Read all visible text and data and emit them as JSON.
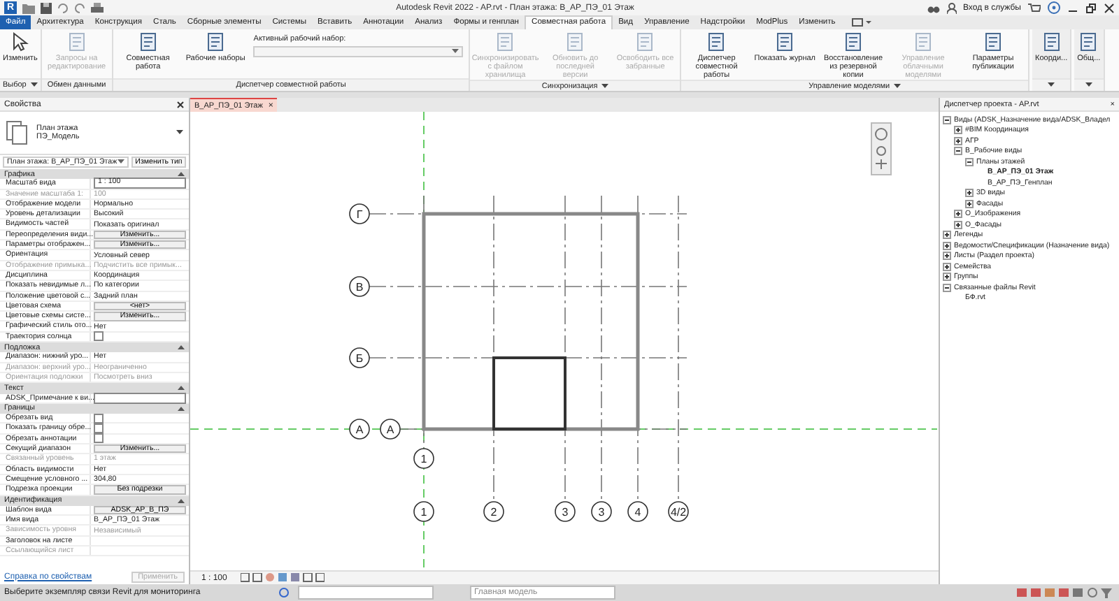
{
  "window": {
    "app_logo": "R",
    "title": "Autodesk Revit 2022 - AP.rvt - План этажа: В_АР_ПЭ_01 Этаж",
    "sign_in": "Вход в службы"
  },
  "ribbon_tabs": [
    {
      "label": "Файл",
      "kind": "file",
      "selected": false
    },
    {
      "label": "Архитектура",
      "kind": "tab",
      "selected": false
    },
    {
      "label": "Конструкция",
      "kind": "tab",
      "selected": false
    },
    {
      "label": "Сталь",
      "kind": "tab",
      "selected": false
    },
    {
      "label": "Сборные элементы",
      "kind": "tab",
      "selected": false
    },
    {
      "label": "Системы",
      "kind": "tab",
      "selected": false
    },
    {
      "label": "Вставить",
      "kind": "tab",
      "selected": false
    },
    {
      "label": "Аннотации",
      "kind": "tab",
      "selected": false
    },
    {
      "label": "Анализ",
      "kind": "tab",
      "selected": false
    },
    {
      "label": "Формы и генплан",
      "kind": "tab",
      "selected": false
    },
    {
      "label": "Совместная работа",
      "kind": "tab",
      "selected": true
    },
    {
      "label": "Вид",
      "kind": "tab",
      "selected": false
    },
    {
      "label": "Управление",
      "kind": "tab",
      "selected": false
    },
    {
      "label": "Надстройки",
      "kind": "tab",
      "selected": false
    },
    {
      "label": "ModPlus",
      "kind": "tab",
      "selected": false
    },
    {
      "label": "Изменить",
      "kind": "tab",
      "selected": false
    }
  ],
  "ribbon_panels": [
    {
      "title": "Выбор",
      "dropdown": true,
      "tools": [
        {
          "label": "Изменить",
          "disabled": false
        }
      ]
    },
    {
      "title": "Обмен данными",
      "dropdown": false,
      "tools": [
        {
          "label": "Запросы на редактирование",
          "disabled": true
        }
      ]
    },
    {
      "title": "Диспетчер совместной работы",
      "dropdown": false,
      "tools": [
        {
          "label": "Совместная работа",
          "disabled": false
        },
        {
          "label": "Рабочие наборы",
          "disabled": false
        }
      ],
      "workset_label": "Активный рабочий набор:"
    },
    {
      "title": "Синхронизация",
      "dropdown": true,
      "tools": [
        {
          "label": "Синхронизировать с файлом хранилища",
          "disabled": true
        },
        {
          "label": "Обновить до последней версии",
          "disabled": true
        },
        {
          "label": "Освободить все забранные",
          "disabled": true
        }
      ]
    },
    {
      "title": "Управление моделями",
      "dropdown": true,
      "tools": [
        {
          "label": "Диспетчер совместной работы",
          "disabled": false
        },
        {
          "label": "Показать журнал",
          "disabled": false
        },
        {
          "label": "Восстановление из резервной копии",
          "disabled": false
        },
        {
          "label": "Управление облачными моделями",
          "disabled": true
        },
        {
          "label": "Параметры публикации",
          "disabled": false
        }
      ]
    },
    {
      "dropdown": true,
      "tools": [
        {
          "label": "Коорди...",
          "disabled": false
        }
      ]
    },
    {
      "dropdown": true,
      "tools": [
        {
          "label": "Общ...",
          "disabled": false
        }
      ]
    }
  ],
  "properties": {
    "title": "Свойства",
    "type_family": "План этажа",
    "type_name": "ПЭ_Модель",
    "instance": "План этажа: В_АР_ПЭ_01 Этаж",
    "edit_type": "Изменить тип",
    "groups": [
      {
        "name": "Графика",
        "rows": [
          {
            "name": "Масштаб вида",
            "value": "1 : 100",
            "kind": "input"
          },
          {
            "name": "Значение масштаба  1:",
            "value": "100",
            "kind": "text",
            "disabled": true
          },
          {
            "name": "Отображение модели",
            "value": "Нормально",
            "kind": "text"
          },
          {
            "name": "Уровень детализации",
            "value": "Высокий",
            "kind": "text"
          },
          {
            "name": "Видимость частей",
            "value": "Показать оригинал",
            "kind": "text"
          },
          {
            "name": "Переопределения види...",
            "value": "Изменить...",
            "kind": "button"
          },
          {
            "name": "Параметры отображен...",
            "value": "Изменить...",
            "kind": "button"
          },
          {
            "name": "Ориентация",
            "value": "Условный север",
            "kind": "text"
          },
          {
            "name": "Отображение примыка...",
            "value": "Подчистить все примык...",
            "kind": "text",
            "disabled": true
          },
          {
            "name": "Дисциплина",
            "value": "Координация",
            "kind": "text"
          },
          {
            "name": "Показать невидимые л...",
            "value": "По категории",
            "kind": "text"
          },
          {
            "name": "Положение цветовой с...",
            "value": "Задний план",
            "kind": "text"
          },
          {
            "name": "Цветовая схема",
            "value": "<нет>",
            "kind": "button"
          },
          {
            "name": "Цветовые схемы систе...",
            "value": "Изменить...",
            "kind": "button"
          },
          {
            "name": "Графический стиль ото...",
            "value": "Нет",
            "kind": "text"
          },
          {
            "name": "Траектория солнца",
            "kind": "checkbox",
            "checked": false
          }
        ]
      },
      {
        "name": "Подложка",
        "rows": [
          {
            "name": "Диапазон: нижний уро...",
            "value": "Нет",
            "kind": "text"
          },
          {
            "name": "Диапазон: верхний уро...",
            "value": "Неограниченно",
            "kind": "text",
            "disabled": true
          },
          {
            "name": "Ориентация подложки",
            "value": "Посмотреть вниз",
            "kind": "text",
            "disabled": true
          }
        ]
      },
      {
        "name": "Текст",
        "rows": [
          {
            "name": "ADSK_Примечание к ви...",
            "kind": "input"
          }
        ]
      },
      {
        "name": "Границы",
        "rows": [
          {
            "name": "Обрезать вид",
            "kind": "checkbox",
            "checked": false
          },
          {
            "name": "Показать границу обре...",
            "kind": "checkbox",
            "checked": false
          },
          {
            "name": "Обрезать аннотации",
            "kind": "checkbox",
            "checked": false
          },
          {
            "name": "Секущий диапазон",
            "value": "Изменить...",
            "kind": "button"
          },
          {
            "name": "Связанный уровень",
            "value": "1 этаж",
            "kind": "text",
            "disabled": true
          },
          {
            "name": "Область видимости",
            "value": "Нет",
            "kind": "text"
          },
          {
            "name": "Смещение условного ...",
            "value": "304,80",
            "kind": "text"
          },
          {
            "name": "Подрезка проекции",
            "value": "Без подрезки",
            "kind": "button"
          }
        ]
      },
      {
        "name": "Идентификация",
        "rows": [
          {
            "name": "Шаблон вида",
            "value": "ADSK_АР_В_ПЭ",
            "kind": "button"
          },
          {
            "name": "Имя вида",
            "value": "В_АР_ПЭ_01 Этаж",
            "kind": "text"
          },
          {
            "name": "Зависимость уровня",
            "value": "Независимый",
            "kind": "text",
            "disabled": true
          },
          {
            "name": "Заголовок на листе",
            "kind": "text"
          },
          {
            "name": "Ссылающийся лист",
            "kind": "text",
            "disabled": true
          }
        ]
      }
    ],
    "help_link": "Справка по свойствам",
    "apply": "Применить"
  },
  "view_tab": {
    "label": "В_АР_ПЭ_01 Этаж",
    "close": "×"
  },
  "plan": {
    "bubbles": [
      "Г",
      "В",
      "Б",
      "А",
      "А",
      "1",
      "1",
      "2",
      "3",
      "3",
      "4",
      "4/2"
    ]
  },
  "view_bar": {
    "scale": "1 : 100"
  },
  "browser": {
    "title": "Диспетчер проекта - AP.rvt",
    "close": "×",
    "tree": [
      {
        "label": "Виды (ADSK_Назначение вида/ADSK_Владел",
        "expanded": true,
        "selected": false,
        "children": [
          {
            "label": "#BIM Координация",
            "expanded": false,
            "selected": false
          },
          {
            "label": "АГР",
            "expanded": false,
            "selected": false
          },
          {
            "label": "В_Рабочие виды",
            "expanded": true,
            "selected": false,
            "children": [
              {
                "label": "Планы этажей",
                "expanded": true,
                "selected": false,
                "children": [
                  {
                    "label": "В_АР_ПЭ_01 Этаж",
                    "selected": true
                  },
                  {
                    "label": "В_АР_ПЭ_Генплан",
                    "selected": false
                  }
                ]
              },
              {
                "label": "3D виды",
                "expanded": false,
                "selected": false
              },
              {
                "label": "Фасады",
                "expanded": false,
                "selected": false
              }
            ]
          },
          {
            "label": "О_Изображения",
            "expanded": false,
            "selected": false
          },
          {
            "label": "О_Фасады",
            "expanded": false,
            "selected": false
          }
        ]
      },
      {
        "label": "Легенды",
        "expanded": false,
        "selected": false
      },
      {
        "label": "Ведомости/Спецификации (Назначение вида)",
        "expanded": false,
        "selected": false
      },
      {
        "label": "Листы (Раздел проекта)",
        "expanded": false,
        "selected": false
      },
      {
        "label": "Семейства",
        "expanded": false,
        "selected": false
      },
      {
        "label": "Группы",
        "expanded": false,
        "selected": false
      },
      {
        "label": "Связанные файлы Revit",
        "expanded": true,
        "selected": false,
        "children": [
          {
            "label": "БФ.rvt",
            "selected": false
          }
        ]
      }
    ]
  },
  "status_bar": {
    "message": "Выберите экземпляр связи Revit для мониторинга",
    "model_field": "Главная модель"
  }
}
